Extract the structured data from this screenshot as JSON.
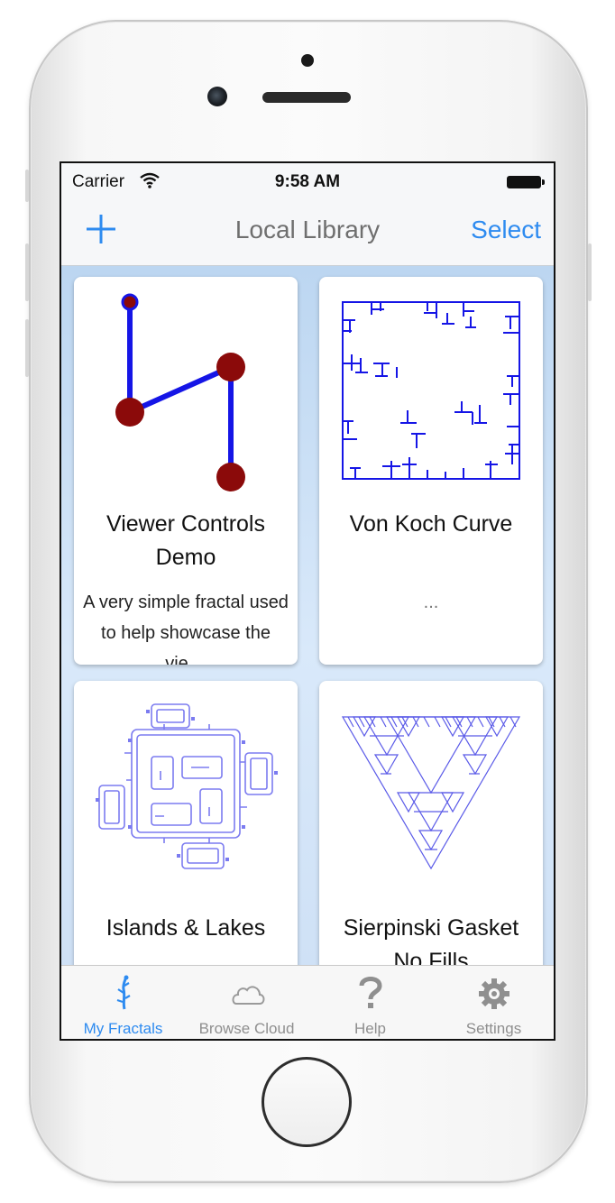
{
  "status_bar": {
    "carrier": "Carrier",
    "time": "9:58 AM"
  },
  "nav": {
    "title": "Local Library",
    "select_label": "Select",
    "add_icon": "plus-icon"
  },
  "cards": [
    {
      "title": "Viewer Controls Demo",
      "description": "A very simple fractal used to help showcase the vie…"
    },
    {
      "title": "Von Koch Curve",
      "description": "..."
    },
    {
      "title": "Islands & Lakes",
      "description": ""
    },
    {
      "title": "Sierpinski Gasket No Fills",
      "description": ""
    }
  ],
  "tabs": [
    {
      "label": "My Fractals",
      "icon": "fractal-tree-icon",
      "active": true
    },
    {
      "label": "Browse Cloud",
      "icon": "cloud-icon",
      "active": false
    },
    {
      "label": "Help",
      "icon": "question-mark-icon",
      "active": false
    },
    {
      "label": "Settings",
      "icon": "gear-icon",
      "active": false
    }
  ],
  "colors": {
    "accent": "#2e8bf0",
    "fractal_blue": "#1515e6",
    "node_red": "#8b0a0a"
  }
}
